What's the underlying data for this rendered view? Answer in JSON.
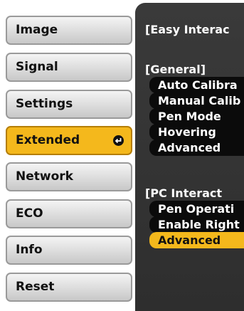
{
  "sidebar": {
    "items": [
      {
        "label": "Image"
      },
      {
        "label": "Signal"
      },
      {
        "label": "Settings"
      },
      {
        "label": "Extended"
      },
      {
        "label": "Network"
      },
      {
        "label": "ECO"
      },
      {
        "label": "Info"
      },
      {
        "label": "Reset"
      }
    ],
    "selected_index": 3
  },
  "panel": {
    "title": "[Easy Interac",
    "general": {
      "heading": "[General]",
      "items": [
        "Auto Calibra",
        "Manual Calib",
        "Pen Mode",
        "Hovering",
        "Advanced"
      ]
    },
    "pc": {
      "heading": "[PC Interact",
      "items": [
        "Pen Operati",
        "Enable Right",
        "Advanced"
      ],
      "selected_index": 2
    }
  },
  "colors": {
    "accent": "#f4b81c",
    "panel_bg": "#333333"
  }
}
